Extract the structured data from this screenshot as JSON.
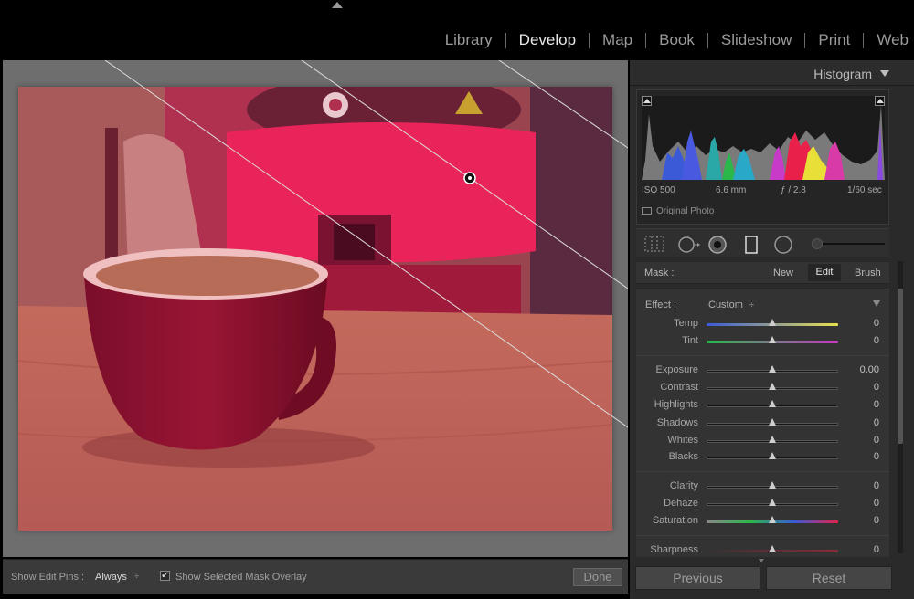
{
  "modules": [
    "Library",
    "Develop",
    "Map",
    "Book",
    "Slideshow",
    "Print",
    "Web"
  ],
  "active_module": "Develop",
  "histogram": {
    "title": "Histogram",
    "iso": "ISO 500",
    "focal": "6.6 mm",
    "aperture": "ƒ / 2.8",
    "shutter": "1/60 sec",
    "original_photo": "Original Photo"
  },
  "mask": {
    "label": "Mask :",
    "new": "New",
    "edit": "Edit",
    "brush": "Brush"
  },
  "effect": {
    "label": "Effect :",
    "value": "Custom",
    "arrows": "÷"
  },
  "adjustments": {
    "temp": {
      "label": "Temp",
      "value": "0"
    },
    "tint": {
      "label": "Tint",
      "value": "0"
    },
    "exposure": {
      "label": "Exposure",
      "value": "0.00"
    },
    "contrast": {
      "label": "Contrast",
      "value": "0"
    },
    "highlights": {
      "label": "Highlights",
      "value": "0"
    },
    "shadows": {
      "label": "Shadows",
      "value": "0"
    },
    "whites": {
      "label": "Whites",
      "value": "0"
    },
    "blacks": {
      "label": "Blacks",
      "value": "0"
    },
    "clarity": {
      "label": "Clarity",
      "value": "0"
    },
    "dehaze": {
      "label": "Dehaze",
      "value": "0"
    },
    "saturation": {
      "label": "Saturation",
      "value": "0"
    },
    "sharpness": {
      "label": "Sharpness",
      "value": "0"
    }
  },
  "toolbar": {
    "show_edit_pins_label": "Show Edit Pins :",
    "show_edit_pins_value": "Always",
    "arrows": "÷",
    "overlay_label": "Show Selected Mask Overlay",
    "overlay_checked": "✔",
    "done": "Done"
  },
  "buttons": {
    "previous": "Previous",
    "reset": "Reset"
  },
  "colors": {
    "mask_overlay": "#e0304a",
    "active_tab": "#e8e8e8"
  }
}
